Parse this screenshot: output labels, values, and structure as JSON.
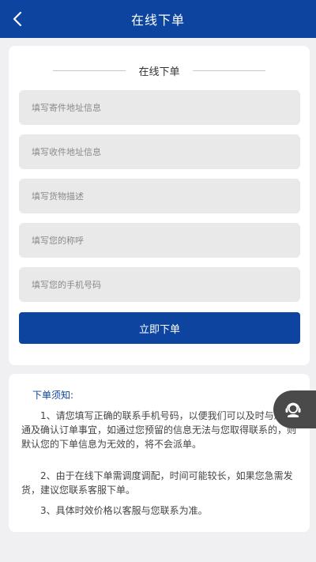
{
  "header": {
    "title": "在线下单"
  },
  "form": {
    "heading": "在线下单",
    "fields": [
      {
        "placeholder": "填写寄件地址信息",
        "value": ""
      },
      {
        "placeholder": "填写收件地址信息",
        "value": ""
      },
      {
        "placeholder": "填写货物描述",
        "value": ""
      },
      {
        "placeholder": "填写您的称呼",
        "value": ""
      },
      {
        "placeholder": "填写您的手机号码",
        "value": ""
      }
    ],
    "submit_label": "立即下单"
  },
  "notice": {
    "title": "下单须知:",
    "items": [
      "1、请您填写正确的联系手机号码，以便我们可以及时与您沟通及确认订单事宜，如通过您预留的信息无法与您取得联系的，则默认您的下单信息为无效的，将不会派单。",
      "2、由于在线下单需调度调配，时间可能较长，如果您急需发货，建议您联系客服下单。",
      "3、具体时效价格以客服与您联系为准。"
    ]
  },
  "icons": {
    "back": "chevron-left-icon",
    "customer_service": "headset-icon"
  },
  "colors": {
    "brand": "#0d44a0",
    "background": "#f0f0f2",
    "field_bg": "#e9e9e9"
  }
}
